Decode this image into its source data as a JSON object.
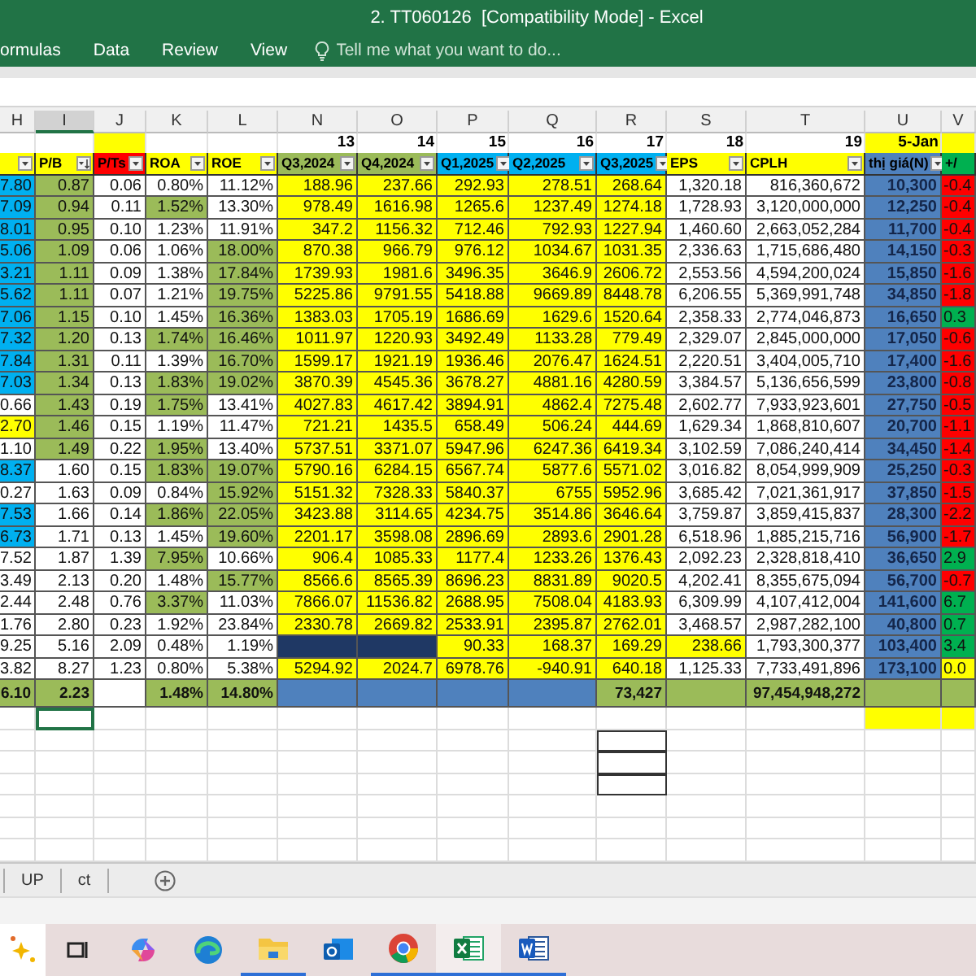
{
  "window": {
    "title": "2. TT060126  [Compatibility Mode] - Excel"
  },
  "ribbon": {
    "tabs": [
      "ormulas",
      "Data",
      "Review",
      "View"
    ],
    "tell_me": {
      "placeholder": "Tell me what you want to do..."
    }
  },
  "table": {
    "column_letters": [
      {
        "text": "H",
        "selected": false
      },
      {
        "text": "I",
        "selected": true
      },
      {
        "text": "J",
        "selected": false
      },
      {
        "text": "K",
        "selected": false
      },
      {
        "text": "L",
        "selected": false
      },
      {
        "text": "N",
        "selected": false
      },
      {
        "text": "O",
        "selected": false
      },
      {
        "text": "P",
        "selected": false
      },
      {
        "text": "Q",
        "selected": false
      },
      {
        "text": "R",
        "selected": false
      },
      {
        "text": "S",
        "selected": false
      },
      {
        "text": "T",
        "selected": false
      },
      {
        "text": "U",
        "selected": false
      },
      {
        "text": "V",
        "selected": false
      }
    ],
    "headers": [
      {
        "color": "#ffff00",
        "filtered": true,
        "sorted": false
      },
      {
        "text": "P/B",
        "color": "#ffff00",
        "filtered": true,
        "sorted": true
      },
      {
        "text": "P/Ts",
        "color": "#ff0000",
        "filtered": true,
        "sorted": false,
        "index_cell": {
          "color": "#ffff00"
        }
      },
      {
        "text": "ROA",
        "color": "#ffff00",
        "filtered": true,
        "sorted": false
      },
      {
        "text": "ROE",
        "color": "#ffff00",
        "filtered": true,
        "sorted": false
      },
      {
        "text": "Q3,2024",
        "color": "#9bbb59",
        "filtered": true,
        "sorted": false,
        "index_cell": {
          "text": "13",
          "color": "#ffffff"
        }
      },
      {
        "text": "Q4,2024",
        "color": "#9bbb59",
        "filtered": true,
        "sorted": false,
        "index_cell": {
          "text": "14",
          "color": "#ffffff"
        }
      },
      {
        "text": "Q1,2025",
        "color": "#00b0f0",
        "filtered": true,
        "sorted": false,
        "index_cell": {
          "text": "15",
          "color": "#ffffff"
        }
      },
      {
        "text": "Q2,2025",
        "color": "#00b0f0",
        "filtered": true,
        "sorted": false,
        "index_cell": {
          "text": "16",
          "color": "#ffffff"
        }
      },
      {
        "text": "Q3,2025",
        "color": "#00b0f0",
        "filtered": true,
        "sorted": false,
        "index_cell": {
          "text": "17",
          "color": "#ffffff"
        }
      },
      {
        "text": "EPS",
        "color": "#ffff00",
        "filtered": true,
        "sorted": false,
        "index_cell": {
          "text": "18",
          "color": "#ffffff"
        }
      },
      {
        "text": "CPLH",
        "color": "#ffff00",
        "filtered": true,
        "sorted": false,
        "index_cell": {
          "text": "19",
          "color": "#ffffff"
        }
      },
      {
        "text": "thị giá(N)",
        "color": "#4f81bd",
        "filtered": true,
        "sorted": false,
        "index_cell": {
          "text": "5-Jan",
          "color": "#ffff00"
        }
      },
      {
        "text": "+/",
        "color": "#00b050",
        "filtered": false,
        "sorted": false,
        "index_cell": {
          "color": "#ffff00"
        }
      }
    ],
    "rows": [
      {
        "cells": [
          {
            "text": "7.80",
            "color": "#00b0f0"
          },
          {
            "text": "0.87",
            "color": "#9bbb59"
          },
          {
            "text": "0.06",
            "color": "#ffffff"
          },
          {
            "text": "0.80%",
            "color": "#ffffff"
          },
          {
            "text": "11.12%",
            "color": "#ffffff"
          },
          {
            "text": "188.96",
            "color": "#ffff00"
          },
          {
            "text": "237.66",
            "color": "#ffff00"
          },
          {
            "text": "292.93",
            "color": "#ffff00"
          },
          {
            "text": "278.51",
            "color": "#ffff00"
          },
          {
            "text": "268.64",
            "color": "#ffff00"
          },
          {
            "text": "1,320.18",
            "color": "#ffffff"
          },
          {
            "text": "816,360,672",
            "color": "#ffffff"
          },
          {
            "text": "10,300",
            "color": "#4f81bd"
          },
          {
            "text": "-0.4",
            "color": "#ff0000"
          }
        ]
      },
      {
        "cells": [
          {
            "text": "7.09",
            "color": "#00b0f0"
          },
          {
            "text": "0.94",
            "color": "#9bbb59"
          },
          {
            "text": "0.11",
            "color": "#ffffff"
          },
          {
            "text": "1.52%",
            "color": "#9bbb59"
          },
          {
            "text": "13.30%",
            "color": "#ffffff"
          },
          {
            "text": "978.49",
            "color": "#ffff00"
          },
          {
            "text": "1616.98",
            "color": "#ffff00"
          },
          {
            "text": "1265.6",
            "color": "#ffff00"
          },
          {
            "text": "1237.49",
            "color": "#ffff00"
          },
          {
            "text": "1274.18",
            "color": "#ffff00"
          },
          {
            "text": "1,728.93",
            "color": "#ffffff"
          },
          {
            "text": "3,120,000,000",
            "color": "#ffffff"
          },
          {
            "text": "12,250",
            "color": "#4f81bd"
          },
          {
            "text": "-0.4",
            "color": "#ff0000"
          }
        ]
      },
      {
        "cells": [
          {
            "text": "8.01",
            "color": "#00b0f0"
          },
          {
            "text": "0.95",
            "color": "#9bbb59"
          },
          {
            "text": "0.10",
            "color": "#ffffff"
          },
          {
            "text": "1.23%",
            "color": "#ffffff"
          },
          {
            "text": "11.91%",
            "color": "#ffffff"
          },
          {
            "text": "347.2",
            "color": "#ffff00"
          },
          {
            "text": "1156.32",
            "color": "#ffff00"
          },
          {
            "text": "712.46",
            "color": "#ffff00"
          },
          {
            "text": "792.93",
            "color": "#ffff00"
          },
          {
            "text": "1227.94",
            "color": "#ffff00"
          },
          {
            "text": "1,460.60",
            "color": "#ffffff"
          },
          {
            "text": "2,663,052,284",
            "color": "#ffffff"
          },
          {
            "text": "11,700",
            "color": "#4f81bd"
          },
          {
            "text": "-0.4",
            "color": "#ff0000"
          }
        ]
      },
      {
        "cells": [
          {
            "text": "5.06",
            "color": "#00b0f0"
          },
          {
            "text": "1.09",
            "color": "#9bbb59"
          },
          {
            "text": "0.06",
            "color": "#ffffff"
          },
          {
            "text": "1.06%",
            "color": "#ffffff"
          },
          {
            "text": "18.00%",
            "color": "#9bbb59"
          },
          {
            "text": "870.38",
            "color": "#ffff00"
          },
          {
            "text": "966.79",
            "color": "#ffff00"
          },
          {
            "text": "976.12",
            "color": "#ffff00"
          },
          {
            "text": "1034.67",
            "color": "#ffff00"
          },
          {
            "text": "1031.35",
            "color": "#ffff00"
          },
          {
            "text": "2,336.63",
            "color": "#ffffff"
          },
          {
            "text": "1,715,686,480",
            "color": "#ffffff"
          },
          {
            "text": "14,150",
            "color": "#4f81bd"
          },
          {
            "text": "-0.3",
            "color": "#ff0000"
          }
        ]
      },
      {
        "cells": [
          {
            "text": "3.21",
            "color": "#00b0f0"
          },
          {
            "text": "1.11",
            "color": "#9bbb59"
          },
          {
            "text": "0.09",
            "color": "#ffffff"
          },
          {
            "text": "1.38%",
            "color": "#ffffff"
          },
          {
            "text": "17.84%",
            "color": "#9bbb59"
          },
          {
            "text": "1739.93",
            "color": "#ffff00"
          },
          {
            "text": "1981.6",
            "color": "#ffff00"
          },
          {
            "text": "3496.35",
            "color": "#ffff00"
          },
          {
            "text": "3646.9",
            "color": "#ffff00"
          },
          {
            "text": "2606.72",
            "color": "#ffff00"
          },
          {
            "text": "2,553.56",
            "color": "#ffffff"
          },
          {
            "text": "4,594,200,024",
            "color": "#ffffff"
          },
          {
            "text": "15,850",
            "color": "#4f81bd"
          },
          {
            "text": "-1.6",
            "color": "#ff0000"
          }
        ]
      },
      {
        "cells": [
          {
            "text": "5.62",
            "color": "#00b0f0"
          },
          {
            "text": "1.11",
            "color": "#9bbb59"
          },
          {
            "text": "0.07",
            "color": "#ffffff"
          },
          {
            "text": "1.21%",
            "color": "#ffffff"
          },
          {
            "text": "19.75%",
            "color": "#9bbb59"
          },
          {
            "text": "5225.86",
            "color": "#ffff00"
          },
          {
            "text": "9791.55",
            "color": "#ffff00"
          },
          {
            "text": "5418.88",
            "color": "#ffff00"
          },
          {
            "text": "9669.89",
            "color": "#ffff00"
          },
          {
            "text": "8448.78",
            "color": "#ffff00"
          },
          {
            "text": "6,206.55",
            "color": "#ffffff"
          },
          {
            "text": "5,369,991,748",
            "color": "#ffffff"
          },
          {
            "text": "34,850",
            "color": "#4f81bd"
          },
          {
            "text": "-1.8",
            "color": "#ff0000"
          }
        ]
      },
      {
        "cells": [
          {
            "text": "7.06",
            "color": "#00b0f0"
          },
          {
            "text": "1.15",
            "color": "#9bbb59"
          },
          {
            "text": "0.10",
            "color": "#ffffff"
          },
          {
            "text": "1.45%",
            "color": "#ffffff"
          },
          {
            "text": "16.36%",
            "color": "#9bbb59"
          },
          {
            "text": "1383.03",
            "color": "#ffff00"
          },
          {
            "text": "1705.19",
            "color": "#ffff00"
          },
          {
            "text": "1686.69",
            "color": "#ffff00"
          },
          {
            "text": "1629.6",
            "color": "#ffff00"
          },
          {
            "text": "1520.64",
            "color": "#ffff00"
          },
          {
            "text": "2,358.33",
            "color": "#ffffff"
          },
          {
            "text": "2,774,046,873",
            "color": "#ffffff"
          },
          {
            "text": "16,650",
            "color": "#4f81bd"
          },
          {
            "text": "0.3",
            "color": "#00b050"
          }
        ]
      },
      {
        "cells": [
          {
            "text": "7.32",
            "color": "#00b0f0"
          },
          {
            "text": "1.20",
            "color": "#9bbb59"
          },
          {
            "text": "0.13",
            "color": "#ffffff"
          },
          {
            "text": "1.74%",
            "color": "#9bbb59"
          },
          {
            "text": "16.46%",
            "color": "#9bbb59"
          },
          {
            "text": "1011.97",
            "color": "#ffff00"
          },
          {
            "text": "1220.93",
            "color": "#ffff00"
          },
          {
            "text": "3492.49",
            "color": "#ffff00"
          },
          {
            "text": "1133.28",
            "color": "#ffff00"
          },
          {
            "text": "779.49",
            "color": "#ffff00"
          },
          {
            "text": "2,329.07",
            "color": "#ffffff"
          },
          {
            "text": "2,845,000,000",
            "color": "#ffffff"
          },
          {
            "text": "17,050",
            "color": "#4f81bd"
          },
          {
            "text": "-0.6",
            "color": "#ff0000"
          }
        ]
      },
      {
        "cells": [
          {
            "text": "7.84",
            "color": "#00b0f0"
          },
          {
            "text": "1.31",
            "color": "#9bbb59"
          },
          {
            "text": "0.11",
            "color": "#ffffff"
          },
          {
            "text": "1.39%",
            "color": "#ffffff"
          },
          {
            "text": "16.70%",
            "color": "#9bbb59"
          },
          {
            "text": "1599.17",
            "color": "#ffff00"
          },
          {
            "text": "1921.19",
            "color": "#ffff00"
          },
          {
            "text": "1936.46",
            "color": "#ffff00"
          },
          {
            "text": "2076.47",
            "color": "#ffff00"
          },
          {
            "text": "1624.51",
            "color": "#ffff00"
          },
          {
            "text": "2,220.51",
            "color": "#ffffff"
          },
          {
            "text": "3,404,005,710",
            "color": "#ffffff"
          },
          {
            "text": "17,400",
            "color": "#4f81bd"
          },
          {
            "text": "-1.6",
            "color": "#ff0000"
          }
        ]
      },
      {
        "cells": [
          {
            "text": "7.03",
            "color": "#00b0f0"
          },
          {
            "text": "1.34",
            "color": "#9bbb59"
          },
          {
            "text": "0.13",
            "color": "#ffffff"
          },
          {
            "text": "1.83%",
            "color": "#9bbb59"
          },
          {
            "text": "19.02%",
            "color": "#9bbb59"
          },
          {
            "text": "3870.39",
            "color": "#ffff00"
          },
          {
            "text": "4545.36",
            "color": "#ffff00"
          },
          {
            "text": "3678.27",
            "color": "#ffff00"
          },
          {
            "text": "4881.16",
            "color": "#ffff00"
          },
          {
            "text": "4280.59",
            "color": "#ffff00"
          },
          {
            "text": "3,384.57",
            "color": "#ffffff"
          },
          {
            "text": "5,136,656,599",
            "color": "#ffffff"
          },
          {
            "text": "23,800",
            "color": "#4f81bd"
          },
          {
            "text": "-0.8",
            "color": "#ff0000"
          }
        ]
      },
      {
        "cells": [
          {
            "text": "0.66",
            "color": "#ffffff"
          },
          {
            "text": "1.43",
            "color": "#9bbb59"
          },
          {
            "text": "0.19",
            "color": "#ffffff"
          },
          {
            "text": "1.75%",
            "color": "#9bbb59"
          },
          {
            "text": "13.41%",
            "color": "#ffffff"
          },
          {
            "text": "4027.83",
            "color": "#ffff00"
          },
          {
            "text": "4617.42",
            "color": "#ffff00"
          },
          {
            "text": "3894.91",
            "color": "#ffff00"
          },
          {
            "text": "4862.4",
            "color": "#ffff00"
          },
          {
            "text": "7275.48",
            "color": "#ffff00"
          },
          {
            "text": "2,602.77",
            "color": "#ffffff"
          },
          {
            "text": "7,933,923,601",
            "color": "#ffffff"
          },
          {
            "text": "27,750",
            "color": "#4f81bd"
          },
          {
            "text": "-0.5",
            "color": "#ff0000"
          }
        ]
      },
      {
        "cells": [
          {
            "text": "2.70",
            "color": "#ffff00"
          },
          {
            "text": "1.46",
            "color": "#9bbb59"
          },
          {
            "text": "0.15",
            "color": "#ffffff"
          },
          {
            "text": "1.19%",
            "color": "#ffffff"
          },
          {
            "text": "11.47%",
            "color": "#ffffff"
          },
          {
            "text": "721.21",
            "color": "#ffff00"
          },
          {
            "text": "1435.5",
            "color": "#ffff00"
          },
          {
            "text": "658.49",
            "color": "#ffff00"
          },
          {
            "text": "506.24",
            "color": "#ffff00"
          },
          {
            "text": "444.69",
            "color": "#ffff00"
          },
          {
            "text": "1,629.34",
            "color": "#ffffff"
          },
          {
            "text": "1,868,810,607",
            "color": "#ffffff"
          },
          {
            "text": "20,700",
            "color": "#4f81bd"
          },
          {
            "text": "-1.1",
            "color": "#ff0000"
          }
        ]
      },
      {
        "cells": [
          {
            "text": "1.10",
            "color": "#ffffff"
          },
          {
            "text": "1.49",
            "color": "#9bbb59"
          },
          {
            "text": "0.22",
            "color": "#ffffff"
          },
          {
            "text": "1.95%",
            "color": "#9bbb59"
          },
          {
            "text": "13.40%",
            "color": "#ffffff"
          },
          {
            "text": "5737.51",
            "color": "#ffff00"
          },
          {
            "text": "3371.07",
            "color": "#ffff00"
          },
          {
            "text": "5947.96",
            "color": "#ffff00"
          },
          {
            "text": "6247.36",
            "color": "#ffff00"
          },
          {
            "text": "6419.34",
            "color": "#ffff00"
          },
          {
            "text": "3,102.59",
            "color": "#ffffff"
          },
          {
            "text": "7,086,240,414",
            "color": "#ffffff"
          },
          {
            "text": "34,450",
            "color": "#4f81bd"
          },
          {
            "text": "-1.4",
            "color": "#ff0000"
          }
        ]
      },
      {
        "cells": [
          {
            "text": "8.37",
            "color": "#00b0f0"
          },
          {
            "text": "1.60",
            "color": "#ffffff"
          },
          {
            "text": "0.15",
            "color": "#ffffff"
          },
          {
            "text": "1.83%",
            "color": "#9bbb59"
          },
          {
            "text": "19.07%",
            "color": "#9bbb59"
          },
          {
            "text": "5790.16",
            "color": "#ffff00"
          },
          {
            "text": "6284.15",
            "color": "#ffff00"
          },
          {
            "text": "6567.74",
            "color": "#ffff00"
          },
          {
            "text": "5877.6",
            "color": "#ffff00"
          },
          {
            "text": "5571.02",
            "color": "#ffff00"
          },
          {
            "text": "3,016.82",
            "color": "#ffffff"
          },
          {
            "text": "8,054,999,909",
            "color": "#ffffff"
          },
          {
            "text": "25,250",
            "color": "#4f81bd"
          },
          {
            "text": "-0.3",
            "color": "#ff0000"
          }
        ]
      },
      {
        "cells": [
          {
            "text": "0.27",
            "color": "#ffffff"
          },
          {
            "text": "1.63",
            "color": "#ffffff"
          },
          {
            "text": "0.09",
            "color": "#ffffff"
          },
          {
            "text": "0.84%",
            "color": "#ffffff"
          },
          {
            "text": "15.92%",
            "color": "#9bbb59"
          },
          {
            "text": "5151.32",
            "color": "#ffff00"
          },
          {
            "text": "7328.33",
            "color": "#ffff00"
          },
          {
            "text": "5840.37",
            "color": "#ffff00"
          },
          {
            "text": "6755",
            "color": "#ffff00"
          },
          {
            "text": "5952.96",
            "color": "#ffff00"
          },
          {
            "text": "3,685.42",
            "color": "#ffffff"
          },
          {
            "text": "7,021,361,917",
            "color": "#ffffff"
          },
          {
            "text": "37,850",
            "color": "#4f81bd"
          },
          {
            "text": "-1.5",
            "color": "#ff0000"
          }
        ]
      },
      {
        "cells": [
          {
            "text": "7.53",
            "color": "#00b0f0"
          },
          {
            "text": "1.66",
            "color": "#ffffff"
          },
          {
            "text": "0.14",
            "color": "#ffffff"
          },
          {
            "text": "1.86%",
            "color": "#9bbb59"
          },
          {
            "text": "22.05%",
            "color": "#9bbb59"
          },
          {
            "text": "3423.88",
            "color": "#ffff00"
          },
          {
            "text": "3114.65",
            "color": "#ffff00"
          },
          {
            "text": "4234.75",
            "color": "#ffff00"
          },
          {
            "text": "3514.86",
            "color": "#ffff00"
          },
          {
            "text": "3646.64",
            "color": "#ffff00"
          },
          {
            "text": "3,759.87",
            "color": "#ffffff"
          },
          {
            "text": "3,859,415,837",
            "color": "#ffffff"
          },
          {
            "text": "28,300",
            "color": "#4f81bd"
          },
          {
            "text": "-2.2",
            "color": "#ff0000"
          }
        ]
      },
      {
        "cells": [
          {
            "text": "6.73",
            "color": "#00b0f0"
          },
          {
            "text": "1.71",
            "color": "#ffffff"
          },
          {
            "text": "0.13",
            "color": "#ffffff"
          },
          {
            "text": "1.45%",
            "color": "#ffffff"
          },
          {
            "text": "19.60%",
            "color": "#9bbb59"
          },
          {
            "text": "2201.17",
            "color": "#ffff00"
          },
          {
            "text": "3598.08",
            "color": "#ffff00"
          },
          {
            "text": "2896.69",
            "color": "#ffff00"
          },
          {
            "text": "2893.6",
            "color": "#ffff00"
          },
          {
            "text": "2901.28",
            "color": "#ffff00"
          },
          {
            "text": "6,518.96",
            "color": "#ffffff"
          },
          {
            "text": "1,885,215,716",
            "color": "#ffffff"
          },
          {
            "text": "56,900",
            "color": "#4f81bd"
          },
          {
            "text": "-1.7",
            "color": "#ff0000"
          }
        ]
      },
      {
        "cells": [
          {
            "text": "7.52",
            "color": "#ffffff"
          },
          {
            "text": "1.87",
            "color": "#ffffff"
          },
          {
            "text": "1.39",
            "color": "#ffffff"
          },
          {
            "text": "7.95%",
            "color": "#9bbb59"
          },
          {
            "text": "10.66%",
            "color": "#ffffff"
          },
          {
            "text": "906.4",
            "color": "#ffff00"
          },
          {
            "text": "1085.33",
            "color": "#ffff00"
          },
          {
            "text": "1177.4",
            "color": "#ffff00"
          },
          {
            "text": "1233.26",
            "color": "#ffff00"
          },
          {
            "text": "1376.43",
            "color": "#ffff00"
          },
          {
            "text": "2,092.23",
            "color": "#ffffff"
          },
          {
            "text": "2,328,818,410",
            "color": "#ffffff"
          },
          {
            "text": "36,650",
            "color": "#4f81bd"
          },
          {
            "text": "2.9",
            "color": "#00b050"
          }
        ]
      },
      {
        "cells": [
          {
            "text": "3.49",
            "color": "#ffffff"
          },
          {
            "text": "2.13",
            "color": "#ffffff"
          },
          {
            "text": "0.20",
            "color": "#ffffff"
          },
          {
            "text": "1.48%",
            "color": "#ffffff"
          },
          {
            "text": "15.77%",
            "color": "#9bbb59"
          },
          {
            "text": "8566.6",
            "color": "#ffff00"
          },
          {
            "text": "8565.39",
            "color": "#ffff00"
          },
          {
            "text": "8696.23",
            "color": "#ffff00"
          },
          {
            "text": "8831.89",
            "color": "#ffff00"
          },
          {
            "text": "9020.5",
            "color": "#ffff00"
          },
          {
            "text": "4,202.41",
            "color": "#ffffff"
          },
          {
            "text": "8,355,675,094",
            "color": "#ffffff"
          },
          {
            "text": "56,700",
            "color": "#4f81bd"
          },
          {
            "text": "-0.7",
            "color": "#ff0000"
          }
        ]
      },
      {
        "cells": [
          {
            "text": "2.44",
            "color": "#ffffff"
          },
          {
            "text": "2.48",
            "color": "#ffffff"
          },
          {
            "text": "0.76",
            "color": "#ffffff"
          },
          {
            "text": "3.37%",
            "color": "#9bbb59"
          },
          {
            "text": "11.03%",
            "color": "#ffffff"
          },
          {
            "text": "7866.07",
            "color": "#ffff00"
          },
          {
            "text": "11536.82",
            "color": "#ffff00"
          },
          {
            "text": "2688.95",
            "color": "#ffff00"
          },
          {
            "text": "7508.04",
            "color": "#ffff00"
          },
          {
            "text": "4183.93",
            "color": "#ffff00"
          },
          {
            "text": "6,309.99",
            "color": "#ffffff"
          },
          {
            "text": "4,107,412,004",
            "color": "#ffffff"
          },
          {
            "text": "141,600",
            "color": "#4f81bd"
          },
          {
            "text": "6.7",
            "color": "#00b050"
          }
        ]
      },
      {
        "cells": [
          {
            "text": "1.76",
            "color": "#ffffff"
          },
          {
            "text": "2.80",
            "color": "#ffffff"
          },
          {
            "text": "0.23",
            "color": "#ffffff"
          },
          {
            "text": "1.92%",
            "color": "#ffffff"
          },
          {
            "text": "23.84%",
            "color": "#ffffff"
          },
          {
            "text": "2330.78",
            "color": "#ffff00"
          },
          {
            "text": "2669.82",
            "color": "#ffff00"
          },
          {
            "text": "2533.91",
            "color": "#ffff00"
          },
          {
            "text": "2395.87",
            "color": "#ffff00"
          },
          {
            "text": "2762.01",
            "color": "#ffff00"
          },
          {
            "text": "3,468.57",
            "color": "#ffffff"
          },
          {
            "text": "2,987,282,100",
            "color": "#ffffff"
          },
          {
            "text": "40,800",
            "color": "#4f81bd"
          },
          {
            "text": "0.7",
            "color": "#00b050"
          }
        ]
      },
      {
        "cells": [
          {
            "text": "9.25",
            "color": "#ffffff"
          },
          {
            "text": "5.16",
            "color": "#ffffff"
          },
          {
            "text": "2.09",
            "color": "#ffffff"
          },
          {
            "text": "0.48%",
            "color": "#ffffff"
          },
          {
            "text": "1.19%",
            "color": "#ffffff"
          },
          {
            "color": "#1f3864"
          },
          {
            "color": "#1f3864"
          },
          {
            "text": "90.33",
            "color": "#ffff00"
          },
          {
            "text": "168.37",
            "color": "#ffff00"
          },
          {
            "text": "169.29",
            "color": "#ffff00"
          },
          {
            "text": "238.66",
            "color": "#ffff00"
          },
          {
            "text": "1,793,300,377",
            "color": "#ffffff"
          },
          {
            "text": "103,400",
            "color": "#4f81bd"
          },
          {
            "text": "3.4",
            "color": "#00b050"
          }
        ]
      },
      {
        "cells": [
          {
            "text": "3.82",
            "color": "#ffffff"
          },
          {
            "text": "8.27",
            "color": "#ffffff"
          },
          {
            "text": "1.23",
            "color": "#ffffff"
          },
          {
            "text": "0.80%",
            "color": "#ffffff"
          },
          {
            "text": "5.38%",
            "color": "#ffffff"
          },
          {
            "text": "5294.92",
            "color": "#ffff00"
          },
          {
            "text": "2024.7",
            "color": "#ffff00"
          },
          {
            "text": "6978.76",
            "color": "#ffff00"
          },
          {
            "text": "-940.91",
            "color": "#ffff00"
          },
          {
            "text": "640.18",
            "color": "#ffff00"
          },
          {
            "text": "1,125.33",
            "color": "#ffffff"
          },
          {
            "text": "7,733,491,896",
            "color": "#ffffff"
          },
          {
            "text": "173,100",
            "color": "#4f81bd"
          },
          {
            "text": "0.0",
            "color": "#ffff00"
          }
        ]
      }
    ],
    "total_row": {
      "cells": [
        {
          "text": "6.10",
          "color": "#9bbb59"
        },
        {
          "text": "2.23",
          "color": "#9bbb59"
        },
        {
          "color": "#ffffff"
        },
        {
          "text": "1.48%",
          "color": "#9bbb59"
        },
        {
          "text": "14.80%",
          "color": "#9bbb59"
        },
        {
          "color": "#4f81bd"
        },
        {
          "color": "#4f81bd"
        },
        {
          "color": "#4f81bd"
        },
        {
          "color": "#4f81bd"
        },
        {
          "text": "73,427",
          "color": "#9bbb59"
        },
        {
          "color": "#9bbb59"
        },
        {
          "text": "97,454,948,272",
          "color": "#9bbb59"
        },
        {
          "color": "#9bbb59"
        },
        {
          "color": "#9bbb59"
        }
      ]
    },
    "blank_row": {
      "cells": [
        {
          "color": "#ffffff"
        },
        {
          "color": "#ffffff"
        },
        {
          "color": "#ffffff"
        },
        {
          "color": "#ffffff"
        },
        {
          "color": "#ffffff"
        },
        {
          "color": "#ffffff"
        },
        {
          "color": "#ffffff"
        },
        {
          "color": "#ffffff"
        },
        {
          "color": "#ffffff"
        },
        {
          "color": "#ffffff"
        },
        {
          "color": "#ffffff"
        },
        {
          "color": "#ffffff"
        },
        {
          "color": "#ffff00"
        },
        {
          "color": "#ffff00"
        }
      ]
    }
  },
  "sheet_tabs": [
    {
      "label": "UP"
    },
    {
      "label": "ct"
    }
  ]
}
